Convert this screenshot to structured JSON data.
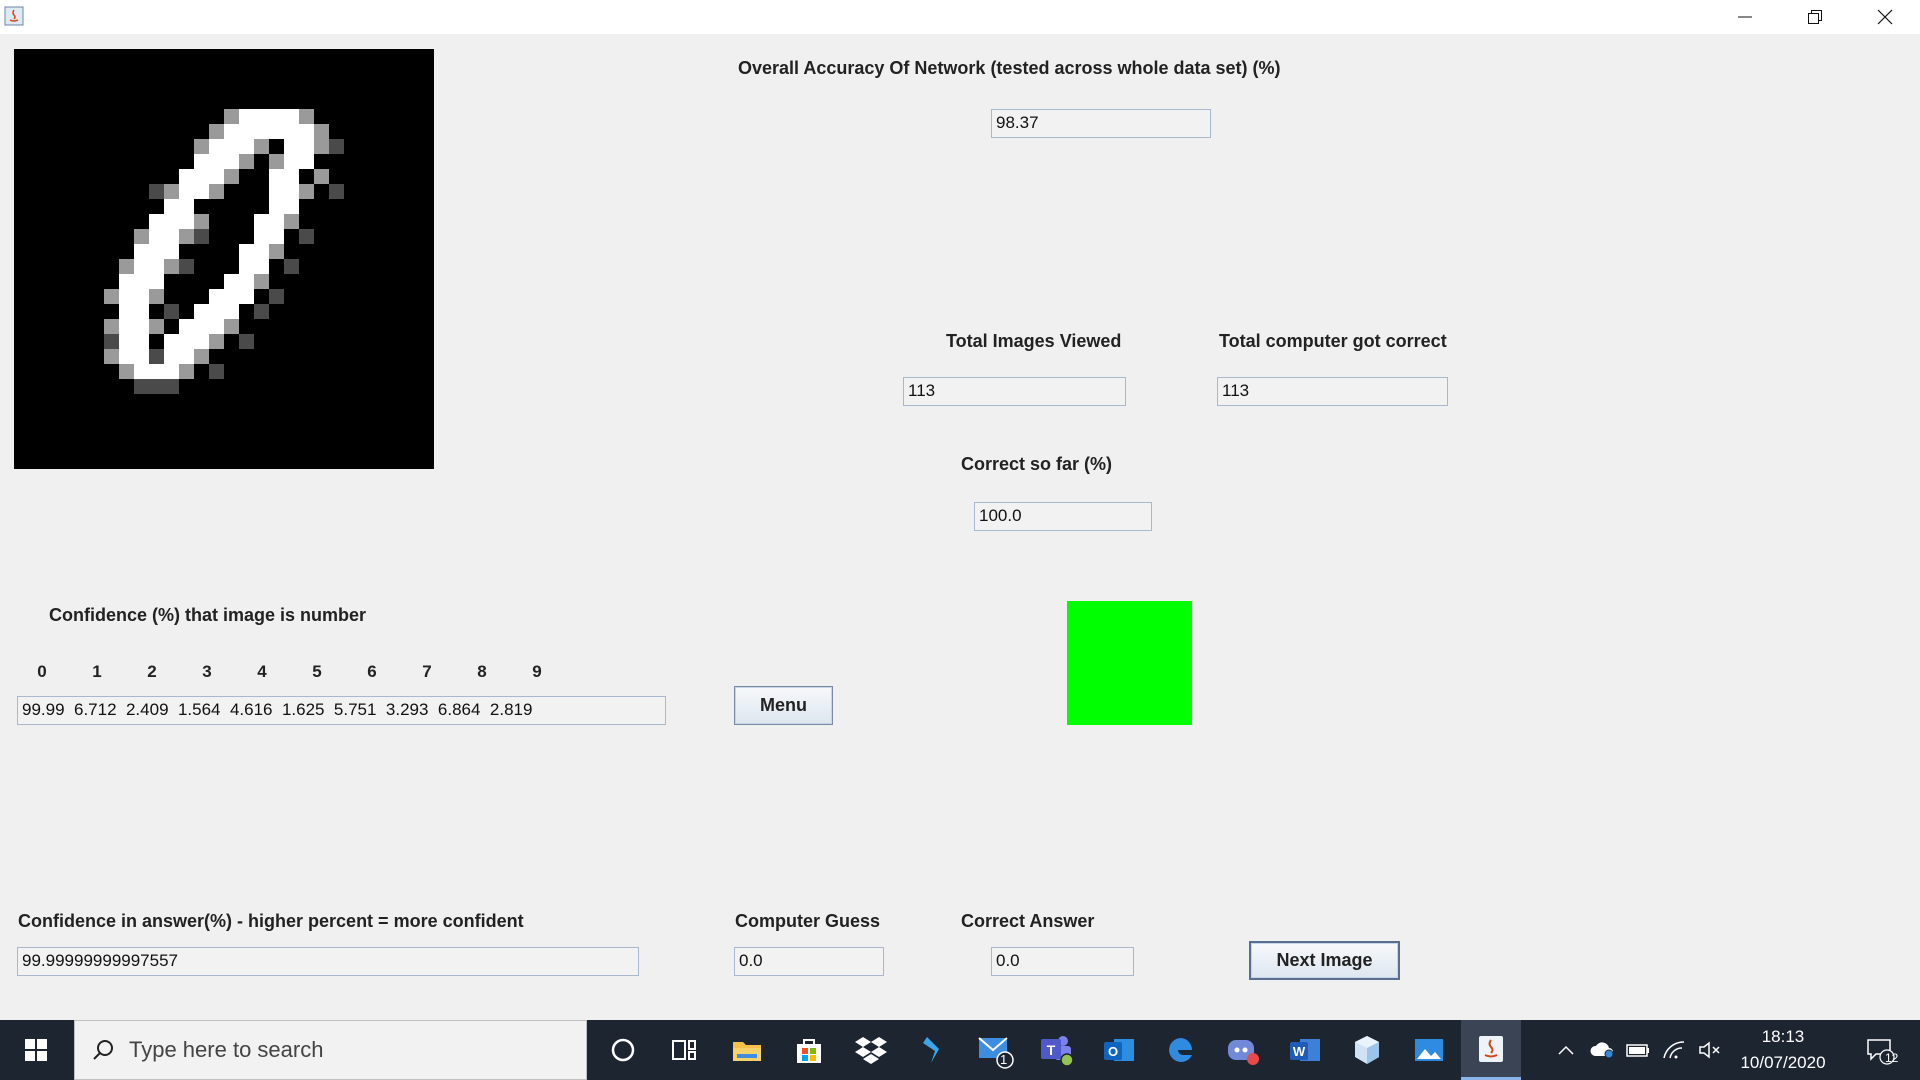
{
  "window": {
    "app_icon": "java-icon",
    "controls": [
      "minimize-icon",
      "restore-icon",
      "close-icon"
    ]
  },
  "overall": {
    "label": "Overall Accuracy Of Network (tested across whole data set) (%)",
    "value": "98.37"
  },
  "totals": {
    "viewed_label": "Total Images Viewed",
    "viewed_value": "113",
    "correct_label": "Total computer got correct",
    "correct_value": "113"
  },
  "correct_so_far": {
    "label": "Correct so far (%)",
    "value": "100.0"
  },
  "confidence": {
    "label": "Confidence (%) that image is number",
    "digits": [
      "0",
      "1",
      "2",
      "3",
      "4",
      "5",
      "6",
      "7",
      "8",
      "9"
    ],
    "values": "99.99  6.712  2.409  1.564  4.616  1.625  5.751  3.293  6.864  2.819"
  },
  "menu_button": "Menu",
  "result_indicator": {
    "color": "#00ff00"
  },
  "answer_confidence": {
    "label": "Confidence in answer(%) - higher percent = more confident",
    "value": "99.99999999997557"
  },
  "guess": {
    "label": "Computer Guess",
    "value": "0.0"
  },
  "answer": {
    "label": "Correct Answer",
    "value": "0.0"
  },
  "next_button": "Next Image",
  "taskbar": {
    "search_placeholder": "Type here to search",
    "time": "18:13",
    "date": "10/07/2020",
    "mail_badge": "1",
    "notification_badge": "12",
    "apps": [
      "cortana-icon",
      "task-view-icon",
      "file-explorer-icon",
      "store-icon",
      "dropbox-icon",
      "visual-studio-icon",
      "mail-icon",
      "teams-icon",
      "outlook-icon",
      "edge-icon",
      "discord-icon",
      "word-icon",
      "3d-viewer-icon",
      "photos-icon",
      "java-icon"
    ]
  }
}
